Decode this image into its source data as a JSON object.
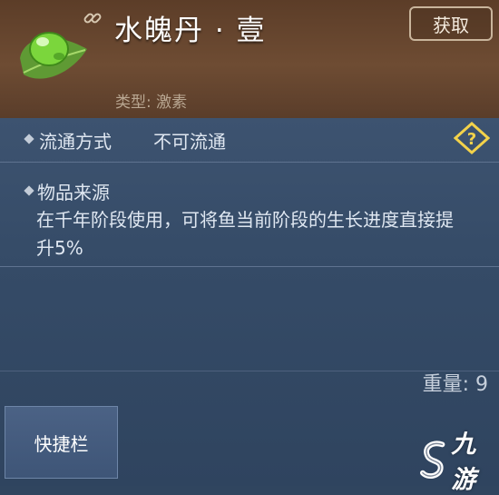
{
  "item": {
    "title": "水魄丹 · 壹",
    "type_line": "类型: 激素",
    "acquire_label": "获取",
    "icon": "green-pill-on-leaf-icon"
  },
  "details": {
    "circulation_label": "流通方式",
    "circulation_value": "不可流通",
    "source_label": "物品来源",
    "source_description": "在千年阶段使用，可将鱼当前阶段的生长进度直接提升5%",
    "weight": "重量: 9"
  },
  "actions": {
    "quickbar_label": "快捷栏"
  },
  "watermark": {
    "text": "九游"
  },
  "colors": {
    "header_bg": "#6e4c33",
    "panel_bg": "#354b67",
    "help_icon": "#f3d24a"
  }
}
